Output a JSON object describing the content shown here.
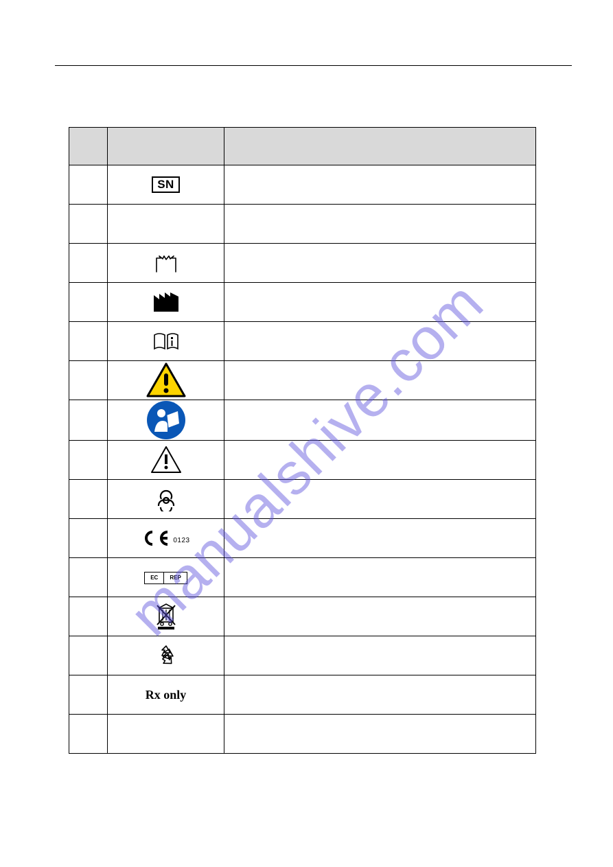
{
  "watermark": "manualshive.com",
  "table": {
    "rows": [
      {
        "symbol": "sn",
        "desc": ""
      },
      {
        "symbol": "",
        "desc": ""
      },
      {
        "symbol": "date-mfg",
        "desc": ""
      },
      {
        "symbol": "manufacturer",
        "desc": ""
      },
      {
        "symbol": "consult-ifu",
        "desc": ""
      },
      {
        "symbol": "warning-yellow",
        "desc": ""
      },
      {
        "symbol": "read-manual-blue",
        "desc": ""
      },
      {
        "symbol": "caution",
        "desc": ""
      },
      {
        "symbol": "biohazard",
        "desc": ""
      },
      {
        "symbol": "ce-0123",
        "desc": ""
      },
      {
        "symbol": "ec-rep",
        "desc": ""
      },
      {
        "symbol": "weee",
        "desc": ""
      },
      {
        "symbol": "recycle",
        "desc": ""
      },
      {
        "symbol": "rx-only",
        "desc": ""
      },
      {
        "symbol": "",
        "desc": ""
      }
    ]
  },
  "labels": {
    "sn": "SN",
    "ce": "CE",
    "ce_number": "0123",
    "ec": "EC",
    "rep": "REP",
    "rx": "Rx only"
  }
}
